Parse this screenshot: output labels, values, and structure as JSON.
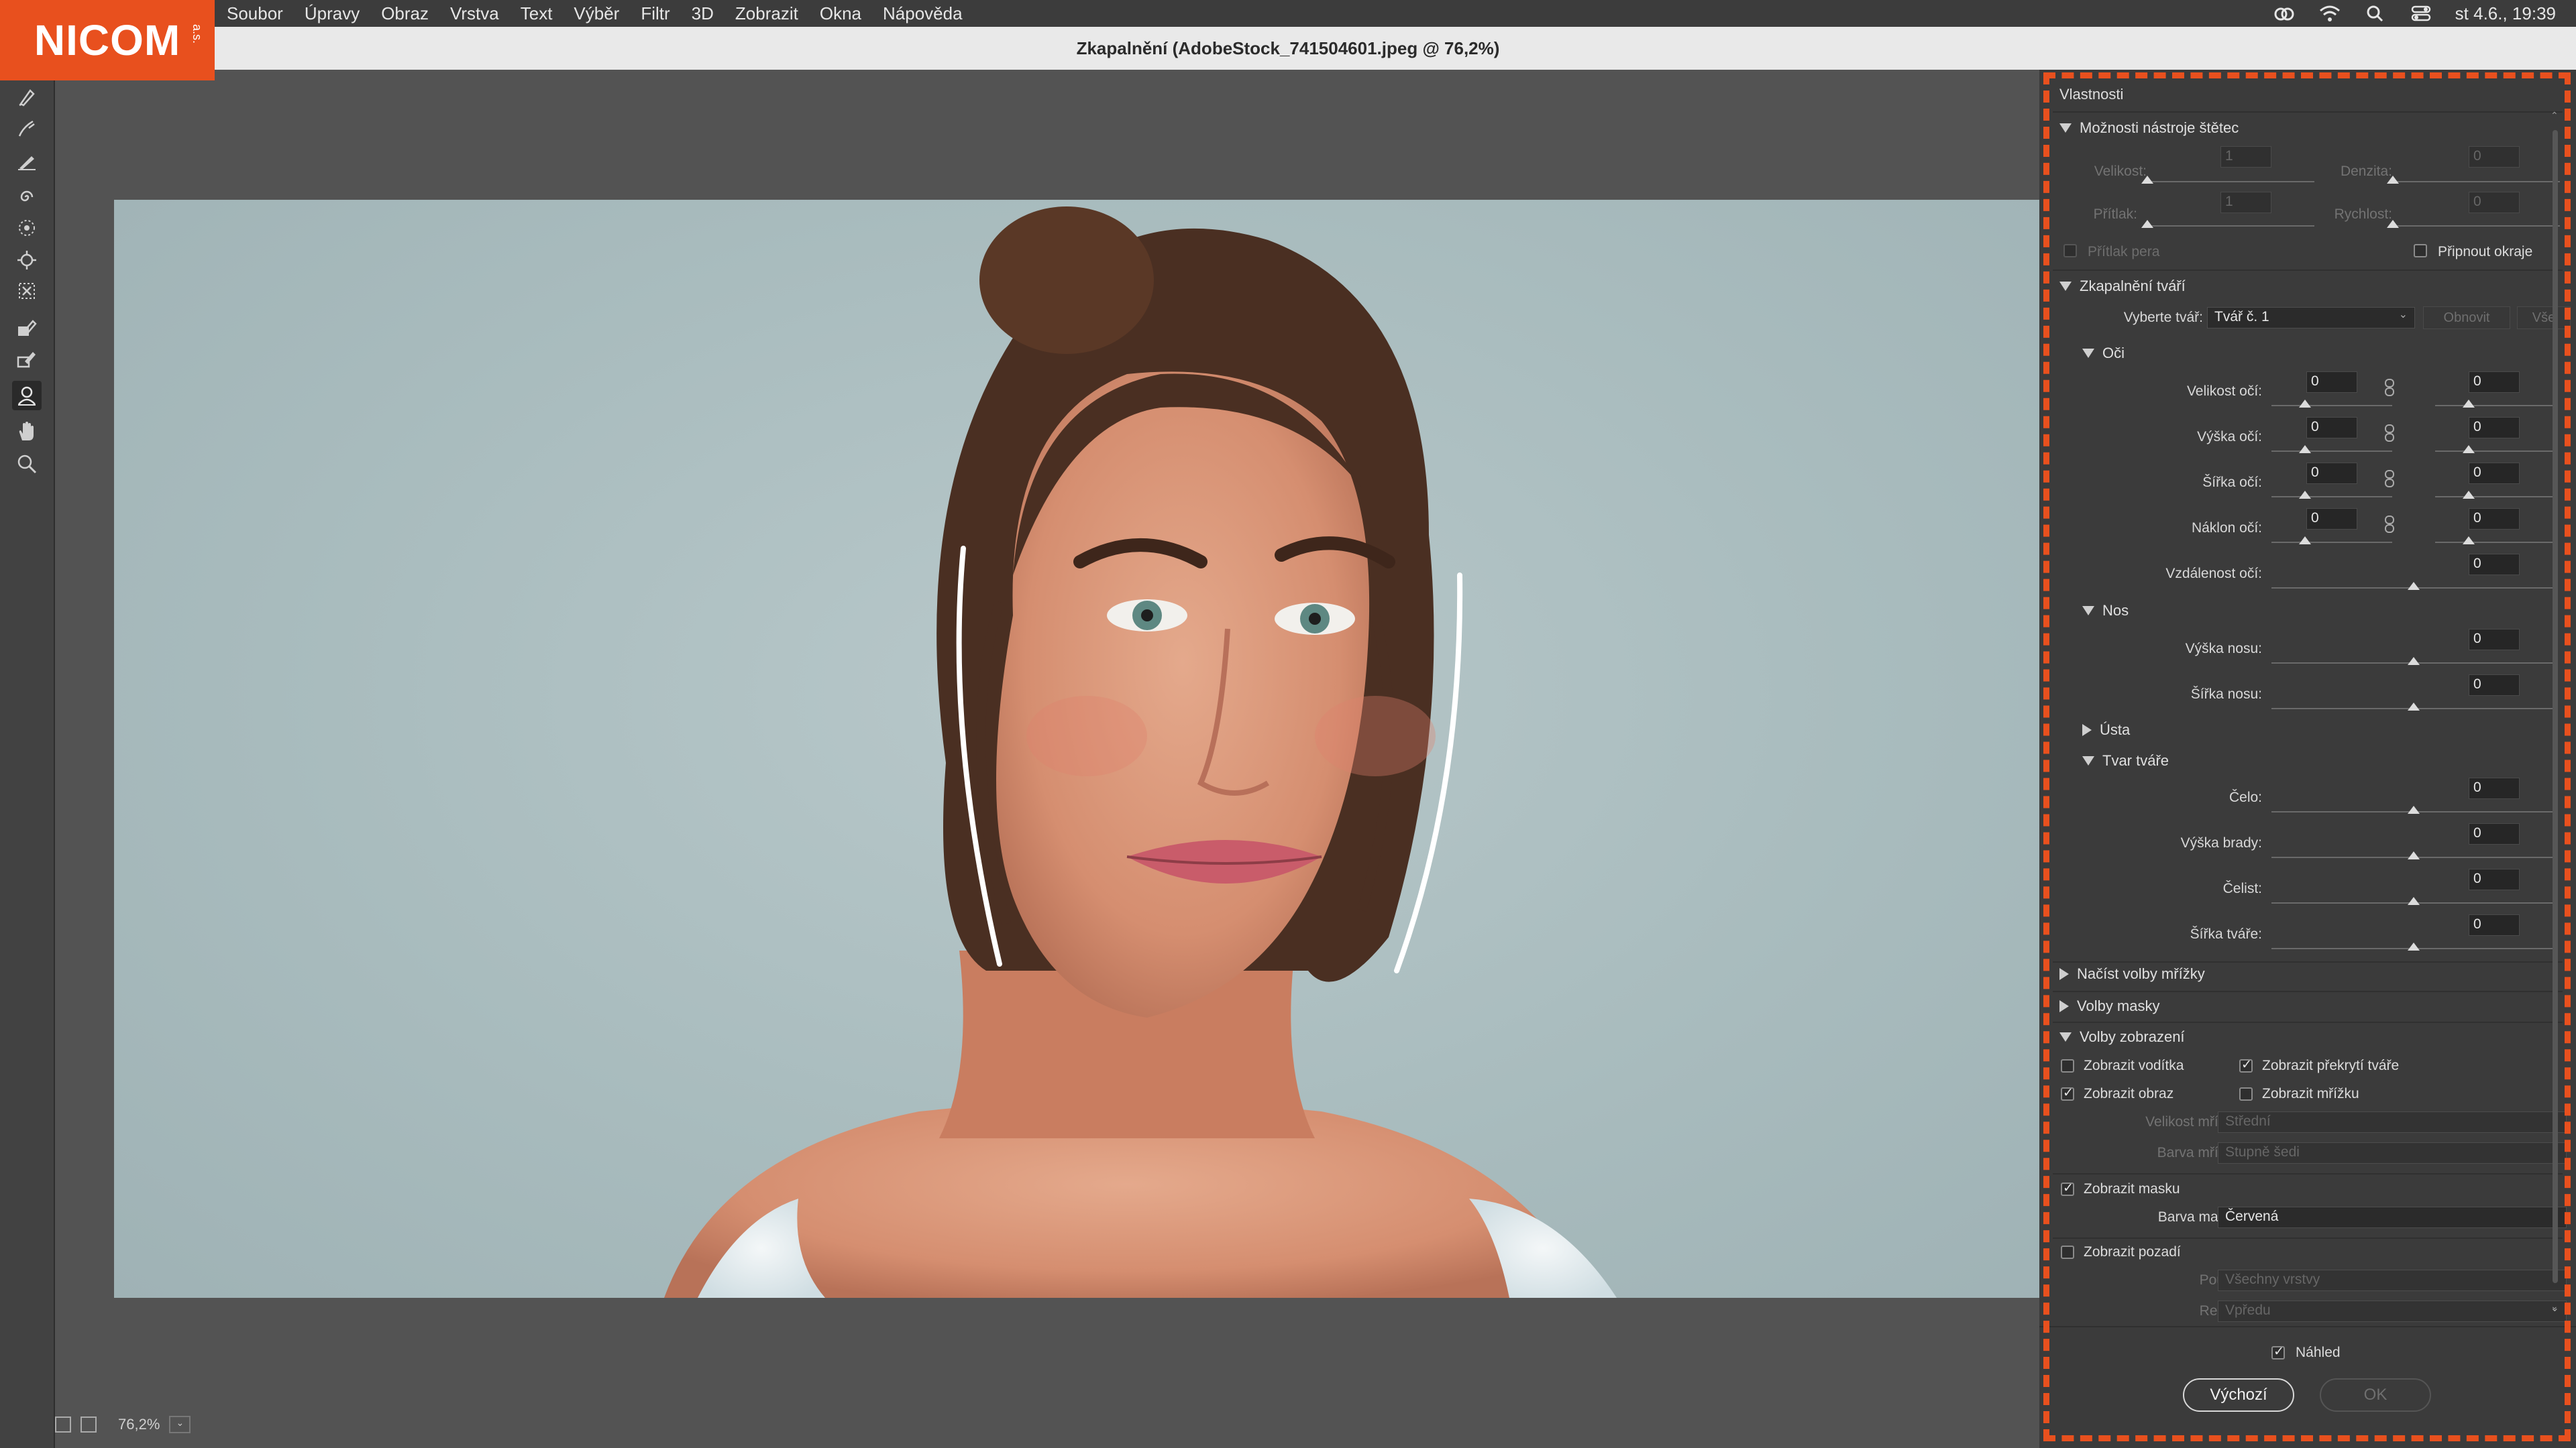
{
  "logo": {
    "text": "NICOM",
    "small": "a.s."
  },
  "menubar": {
    "items": [
      "Soubor",
      "Úpravy",
      "Obraz",
      "Vrstva",
      "Text",
      "Výběr",
      "Filtr",
      "3D",
      "Zobrazit",
      "Okna",
      "Nápověda"
    ],
    "clock": "st 4.6., 19:39",
    "status_icons": [
      "creative-cloud-icon",
      "wifi-icon",
      "spotlight-search-icon",
      "control-center-icon"
    ]
  },
  "window": {
    "title": "Zkapalnění (AdobeStock_741504601.jpeg @ 76,2%)"
  },
  "toolbar": {
    "tools": [
      "forward-warp-icon",
      "reconstruct-icon",
      "smooth-icon",
      "twirl-icon",
      "pucker-icon",
      "bloat-icon",
      "push-left-icon",
      "freeze-mask-icon",
      "thaw-mask-icon",
      "face-tool-icon",
      "hand-icon",
      "zoom-icon"
    ]
  },
  "status": {
    "zoom": "76,2%"
  },
  "panel": {
    "title": "Vlastnosti",
    "brush_section": {
      "title": "Možnosti nástroje štětec",
      "size_label": "Velikost:",
      "size_value": "1",
      "density_label": "Denzita:",
      "density_value": "0",
      "pressure_label": "Přítlak:",
      "pressure_value": "1",
      "rate_label": "Rychlost:",
      "rate_value": "0",
      "pen_pressure_label": "Přítlak pera",
      "pin_edges_label": "Připnout okraje"
    },
    "face_section": {
      "title": "Zkapalnění tváří",
      "select_face_label": "Vyberte tvář:",
      "select_face_value": "Tvář č. 1",
      "reset_label": "Obnovit",
      "all_label": "Vše",
      "eyes": {
        "title": "Oči",
        "rows": [
          {
            "label": "Velikost očí:",
            "left": "0",
            "right": "0"
          },
          {
            "label": "Výška očí:",
            "left": "0",
            "right": "0"
          },
          {
            "label": "Šířka očí:",
            "left": "0",
            "right": "0"
          },
          {
            "label": "Náklon očí:",
            "left": "0",
            "right": "0"
          }
        ],
        "distance_label": "Vzdálenost očí:",
        "distance_value": "0"
      },
      "nose": {
        "title": "Nos",
        "height_label": "Výška nosu:",
        "height_value": "0",
        "width_label": "Šířka nosu:",
        "width_value": "0"
      },
      "mouth_title": "Ústa",
      "shape": {
        "title": "Tvar tváře",
        "forehead_label": "Čelo:",
        "forehead_value": "0",
        "chin_label": "Výška brady:",
        "chin_value": "0",
        "jaw_label": "Čelist:",
        "jaw_value": "0",
        "face_width_label": "Šířka tváře:",
        "face_width_value": "0"
      }
    },
    "load_mesh_title": "Načíst volby mřížky",
    "mask_options_title": "Volby masky",
    "view_section": {
      "title": "Volby zobrazení",
      "show_guides": "Zobrazit vodítka",
      "show_face_overlay": "Zobrazit překrytí tváře",
      "show_image": "Zobrazit obraz",
      "show_mesh": "Zobrazit mřížku",
      "mesh_size_label": "Velikost mřížky:",
      "mesh_size_value": "Střední",
      "mesh_color_label": "Barva mřížky:",
      "mesh_color_value": "Stupně šedi",
      "show_mask": "Zobrazit masku",
      "mask_color_label": "Barva masky:",
      "mask_color_value": "Červená",
      "show_backdrop": "Zobrazit pozadí",
      "use_label": "Použít:",
      "use_value": "Všechny vrstvy",
      "mode_label": "Režim:",
      "mode_value": "Vpředu"
    },
    "preview_label": "Náhled",
    "default_button": "Výchozí",
    "ok_button": "OK"
  },
  "colors": {
    "accent": "#e8501e",
    "panel_bg": "#3b3b3b",
    "canvas_bg": "#535353"
  }
}
